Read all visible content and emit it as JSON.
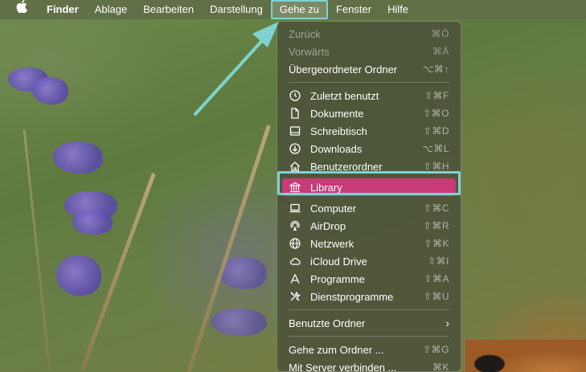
{
  "menubar": {
    "apple": "",
    "items": [
      "Finder",
      "Ablage",
      "Bearbeiten",
      "Darstellung",
      "Gehe zu",
      "Fenster",
      "Hilfe"
    ]
  },
  "menu": {
    "nav": [
      {
        "label": "Zurück",
        "shortcut": "⌘Ö"
      },
      {
        "label": "Vorwärts",
        "shortcut": "⌘Ä"
      },
      {
        "label": "Übergeordneter Ordner",
        "shortcut": "⌥⌘↑"
      }
    ],
    "places": [
      {
        "label": "Zuletzt benutzt",
        "shortcut": "⇧⌘F",
        "icon": "clock-icon"
      },
      {
        "label": "Dokumente",
        "shortcut": "⇧⌘O",
        "icon": "document-icon"
      },
      {
        "label": "Schreibtisch",
        "shortcut": "⇧⌘D",
        "icon": "desktop-icon"
      },
      {
        "label": "Downloads",
        "shortcut": "⌥⌘L",
        "icon": "download-icon"
      },
      {
        "label": "Benutzerordner",
        "shortcut": "⇧⌘H",
        "icon": "home-icon"
      },
      {
        "label": "Library",
        "shortcut": "",
        "icon": "library-icon"
      },
      {
        "label": "Computer",
        "shortcut": "⇧⌘C",
        "icon": "computer-icon"
      },
      {
        "label": "AirDrop",
        "shortcut": "⇧⌘R",
        "icon": "airdrop-icon"
      },
      {
        "label": "Netzwerk",
        "shortcut": "⇧⌘K",
        "icon": "network-icon"
      },
      {
        "label": "iCloud Drive",
        "shortcut": "⇧⌘I",
        "icon": "icloud-icon"
      },
      {
        "label": "Programme",
        "shortcut": "⇧⌘A",
        "icon": "applications-icon"
      },
      {
        "label": "Dienstprogramme",
        "shortcut": "⇧⌘U",
        "icon": "utilities-icon"
      }
    ],
    "recent": {
      "label": "Benutzte Ordner"
    },
    "goto": [
      {
        "label": "Gehe zum Ordner ...",
        "shortcut": "⇧⌘G"
      },
      {
        "label": "Mit Server verbinden ...",
        "shortcut": "⌘K"
      }
    ]
  },
  "colors": {
    "highlight": "#c93a78",
    "annotation": "#7fd3d0"
  }
}
